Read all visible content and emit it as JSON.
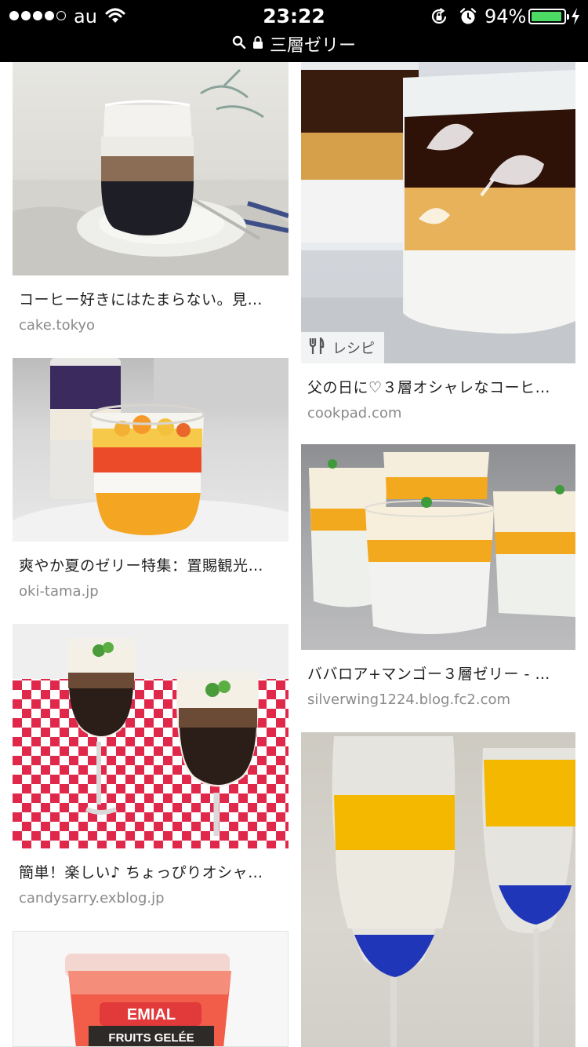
{
  "status_bar": {
    "carrier": "au",
    "time": "23:22",
    "battery_percent": "94%",
    "battery_level": 0.94,
    "signal_bars": 4,
    "signal_total": 5
  },
  "url_bar": {
    "query": "三層ゼリー"
  },
  "results": {
    "left": [
      {
        "title": "コーヒー好きにはたまらない。見…",
        "domain": "cake.tokyo"
      },
      {
        "title": "爽やか夏のゼリー特集：置賜観光…",
        "domain": "oki-tama.jp"
      },
      {
        "title": "簡単！楽しい♪ ちょっぴりオシャ…",
        "domain": "candysarry.exblog.jp"
      },
      {
        "title": "",
        "domain": ""
      }
    ],
    "right": [
      {
        "title": "父の日に♡３層オシャレなコーヒ…",
        "domain": "cookpad.com",
        "badge": "レシピ"
      },
      {
        "title": "ババロア+マンゴー３層ゼリー - …",
        "domain": "silverwing1224.blog.fc2.com"
      },
      {
        "title": "",
        "domain": ""
      }
    ]
  },
  "colors": {
    "topbar_bg": "#000000",
    "battery_green": "#4cd964",
    "domain_gray": "#8a8a8a"
  },
  "icons": [
    "search-icon",
    "lock-icon",
    "wifi-icon",
    "rotation-lock-icon",
    "alarm-icon",
    "charging-bolt-icon",
    "fork-knife-icon"
  ]
}
